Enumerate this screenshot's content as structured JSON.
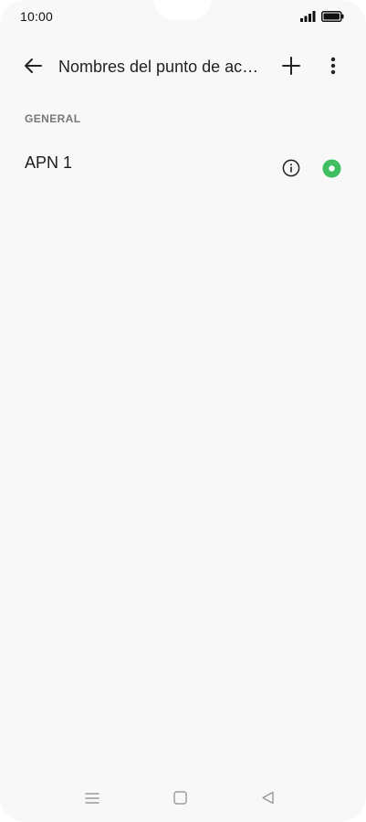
{
  "status_bar": {
    "time": "10:00",
    "icons": [
      "signal-icon",
      "battery-icon"
    ]
  },
  "app_bar": {
    "title": "Nombres del punto de acceso",
    "icons": [
      "back-arrow-icon",
      "plus-icon",
      "more-vert-icon"
    ]
  },
  "section": {
    "label": "GENERAL"
  },
  "apn_list": [
    {
      "name": "APN 1",
      "selected": true
    }
  ],
  "nav_bar": {
    "icons": [
      "menu-icon",
      "home-square-icon",
      "back-triangle-icon"
    ]
  },
  "colors": {
    "background": "#f8f8f8",
    "accent_green": "#3fbf62",
    "text_primary": "#1c1c1c",
    "text_secondary": "#777777",
    "nav_icon": "#9a9a9a"
  }
}
